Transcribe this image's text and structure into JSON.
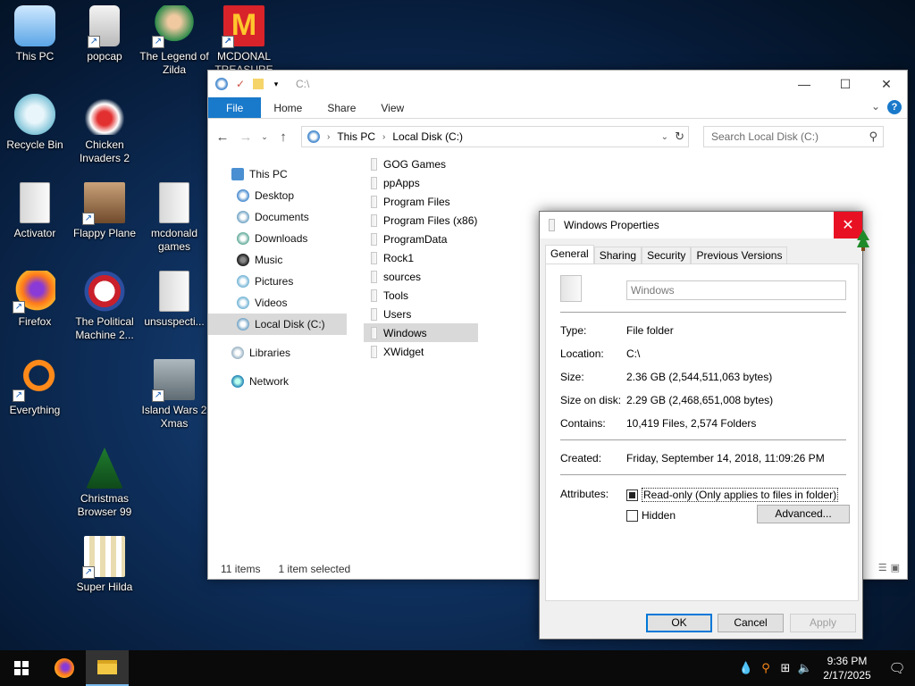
{
  "desktop": {
    "icons": [
      {
        "label": "This PC"
      },
      {
        "label": "popcap"
      },
      {
        "label": "The Legend of Zilda"
      },
      {
        "label": "MCDONAL TREASURE"
      },
      {
        "label": "Recycle Bin"
      },
      {
        "label": "Chicken Invaders 2"
      },
      {
        "label": "Activator"
      },
      {
        "label": "Flappy Plane"
      },
      {
        "label": "mcdonald games"
      },
      {
        "label": "Firefox"
      },
      {
        "label": "The Political Machine 2..."
      },
      {
        "label": "unsuspecti..."
      },
      {
        "label": "Everything"
      },
      {
        "label": "Island Wars 2 Xmas"
      },
      {
        "label": "Christmas Browser 99"
      },
      {
        "label": "Super Hilda"
      }
    ]
  },
  "explorer": {
    "title": "C:\\",
    "ribbon_tabs": [
      "File",
      "Home",
      "Share",
      "View"
    ],
    "address": {
      "root": "This PC",
      "current": "Local Disk (C:)"
    },
    "search_placeholder": "Search Local Disk (C:)",
    "nav": [
      {
        "label": "This PC",
        "icon": "computer-icon"
      },
      {
        "label": "Desktop",
        "icon": "desktop-icon"
      },
      {
        "label": "Documents",
        "icon": "documents-icon"
      },
      {
        "label": "Downloads",
        "icon": "downloads-icon"
      },
      {
        "label": "Music",
        "icon": "music-icon"
      },
      {
        "label": "Pictures",
        "icon": "pictures-icon"
      },
      {
        "label": "Videos",
        "icon": "videos-icon"
      },
      {
        "label": "Local Disk (C:)",
        "icon": "drive-icon"
      },
      {
        "label": "Libraries",
        "icon": "libraries-icon"
      },
      {
        "label": "Network",
        "icon": "network-icon"
      }
    ],
    "files": [
      "GOG Games",
      "ppApps",
      "Program Files",
      "Program Files (x86)",
      "ProgramData",
      "Rock1",
      "sources",
      "Tools",
      "Users",
      "Windows",
      "XWidget"
    ],
    "selected_file": "Windows",
    "status": {
      "count": "11 items",
      "selection": "1 item selected"
    }
  },
  "properties": {
    "title": "Windows Properties",
    "tabs": [
      "General",
      "Sharing",
      "Security",
      "Previous Versions"
    ],
    "name_value": "Windows",
    "rows": {
      "type": {
        "k": "Type:",
        "v": "File folder"
      },
      "location": {
        "k": "Location:",
        "v": "C:\\"
      },
      "size": {
        "k": "Size:",
        "v": "2.36 GB (2,544,511,063 bytes)"
      },
      "size_on_disk": {
        "k": "Size on disk:",
        "v": "2.29 GB (2,468,651,008 bytes)"
      },
      "contains": {
        "k": "Contains:",
        "v": "10,419 Files, 2,574 Folders"
      },
      "created": {
        "k": "Created:",
        "v": "Friday, September 14, 2018, 11:09:26 PM"
      }
    },
    "attributes_label": "Attributes:",
    "readonly_label": "Read-only (Only applies to files in folder)",
    "hidden_label": "Hidden",
    "advanced_label": "Advanced...",
    "ok": "OK",
    "cancel": "Cancel",
    "apply": "Apply"
  },
  "taskbar": {
    "time": "9:36 PM",
    "date": "2/17/2025"
  },
  "colors": {
    "accent": "#1979ca",
    "close_red": "#e81123",
    "selection": "#d9d9d9"
  }
}
